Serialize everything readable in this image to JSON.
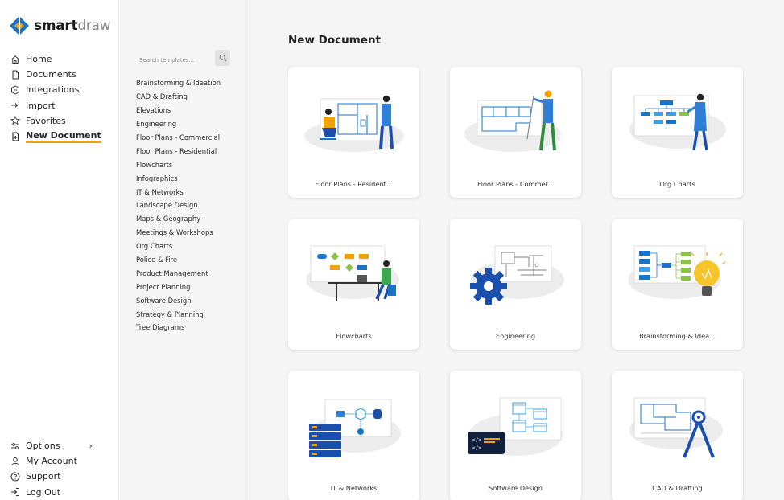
{
  "brand": {
    "name_bold": "smart",
    "name_light": "draw"
  },
  "nav": {
    "items": [
      {
        "label": "Home",
        "icon": "home-icon"
      },
      {
        "label": "Documents",
        "icon": "document-icon"
      },
      {
        "label": "Integrations",
        "icon": "integrations-icon"
      },
      {
        "label": "Import",
        "icon": "import-icon"
      },
      {
        "label": "Favorites",
        "icon": "star-icon"
      },
      {
        "label": "New Document",
        "icon": "new-document-icon",
        "active": true
      }
    ],
    "bottom": [
      {
        "label": "Options",
        "icon": "options-icon"
      },
      {
        "label": "My Account",
        "icon": "user-icon"
      },
      {
        "label": "Support",
        "icon": "help-icon"
      },
      {
        "label": "Log Out",
        "icon": "logout-icon"
      }
    ]
  },
  "search": {
    "placeholder": "Search templates..."
  },
  "categories": [
    "Brainstorming & Ideation",
    "CAD & Drafting",
    "Elevations",
    "Engineering",
    "Floor Plans - Commercial",
    "Floor Plans - Residential",
    "Flowcharts",
    "Infographics",
    "IT & Networks",
    "Landscape Design",
    "Maps & Geography",
    "Meetings & Workshops",
    "Org Charts",
    "Police & Fire",
    "Product Management",
    "Project Planning",
    "Software Design",
    "Strategy & Planning",
    "Tree Diagrams"
  ],
  "main": {
    "title": "New Document",
    "cards": [
      {
        "label": "Floor Plans - Resident...",
        "art": "floor-plan-residential"
      },
      {
        "label": "Floor Plans - Commer...",
        "art": "floor-plan-commercial"
      },
      {
        "label": "Org Charts",
        "art": "org-chart"
      },
      {
        "label": "Flowcharts",
        "art": "flowchart"
      },
      {
        "label": "Engineering",
        "art": "engineering"
      },
      {
        "label": "Brainstorming & Idea...",
        "art": "brainstorming"
      },
      {
        "label": "IT & Networks",
        "art": "it-networks"
      },
      {
        "label": "Software Design",
        "art": "software-design"
      },
      {
        "label": "CAD & Drafting",
        "art": "cad-drafting"
      }
    ]
  },
  "colors": {
    "brand_blue": "#1a73c9",
    "accent_orange": "#f2a100",
    "panel_gray": "#f5f5f5"
  }
}
